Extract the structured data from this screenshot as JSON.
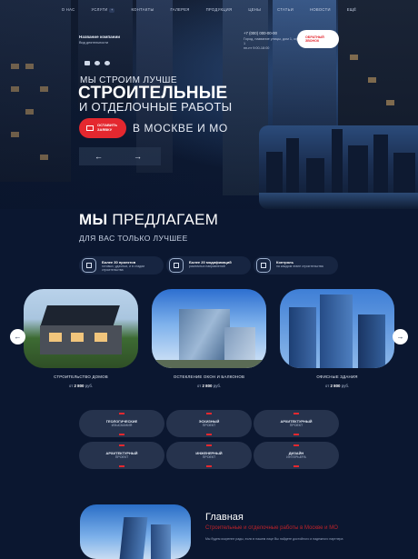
{
  "nav": [
    {
      "label": "О нас"
    },
    {
      "label": "Услуги",
      "badge": "+"
    },
    {
      "label": "Контакты"
    },
    {
      "label": "Галерея"
    },
    {
      "label": "Продукция"
    },
    {
      "label": "Цены"
    },
    {
      "label": "Статьи"
    },
    {
      "label": "Новости"
    },
    {
      "label": "Ещё"
    }
  ],
  "header": {
    "company_name": "Название компании",
    "company_sub": "Вид деятельности",
    "phone": "+7 (000) 000-00-00",
    "address": "Город, название улицы, дом 1, оф 1",
    "hours": "пн-пт 9:00-18:00",
    "callback": [
      "ОБРАТНЫЙ",
      "ЗВОНОК"
    ],
    "socials": [
      "vk-icon",
      "telegram-icon",
      "whatsapp-icon"
    ]
  },
  "hero": {
    "line1": "Мы строим лучше",
    "line2": "Строительные",
    "line3": "и отделочные работы",
    "cta": [
      "Оставить",
      "заявку"
    ],
    "city": "в Москве и МО",
    "prev": "←",
    "next": "→"
  },
  "offers": {
    "title_bold": "МЫ",
    "title_rest": " ПРЕДЛАГАЕМ",
    "subtitle": "Для вас только лучшее",
    "features": [
      {
        "icon": "document-icon",
        "title": "Более 30 проектов",
        "text": "готовых, удачных, и в стадии строительства"
      },
      {
        "icon": "drill-icon",
        "title": "Более 20 модификаций",
        "text": "различных направлений"
      },
      {
        "icon": "tools-icon",
        "title": "Контроль",
        "text": "на каждом этапе строительства"
      }
    ],
    "cards": [
      {
        "title": "Строительство домов",
        "price_prefix": "от",
        "price": "2 800",
        "unit": "руб."
      },
      {
        "title": "Остекление окон и балконов",
        "price_prefix": "от",
        "price": "2 800",
        "unit": "руб."
      },
      {
        "title": "Офисные здания",
        "price_prefix": "от",
        "price": "2 800",
        "unit": "руб."
      }
    ],
    "prev": "←",
    "next": "→"
  },
  "services": [
    {
      "l1": "Геологические",
      "l2": "изыскания"
    },
    {
      "l1": "Эскизный",
      "l2": "проект"
    },
    {
      "l1": "Архитектурный",
      "l2": "проект"
    },
    {
      "l1": "Архитектурный",
      "l2": "проект"
    },
    {
      "l1": "Инженерный",
      "l2": "проект"
    },
    {
      "l1": "Дизайн",
      "l2": "интерьера"
    }
  ],
  "bottom": {
    "title": "Главная",
    "red": "Строительные и отделочные работы в Москве и МО",
    "text": "Мы будем искренне рады, если в нашем лице Вы найдете достойного и надежного партнера"
  },
  "colors": {
    "accent": "#e4282f",
    "background": "#0b1730"
  }
}
